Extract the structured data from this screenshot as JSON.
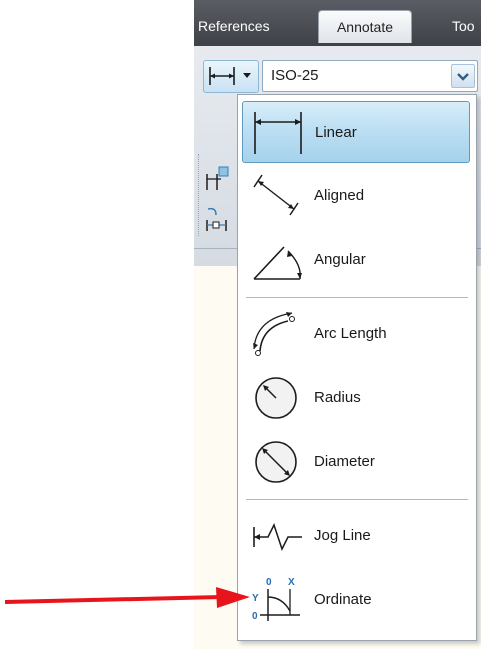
{
  "ribbon": {
    "tabs": [
      {
        "label": "References"
      },
      {
        "label": "Annotate",
        "active": true
      },
      {
        "label": "Too"
      }
    ]
  },
  "dim_style": {
    "value": "ISO-25"
  },
  "dimension_menu": {
    "selected_item": "Linear",
    "items": [
      {
        "label": "Linear",
        "icon": "linear-dimension-icon"
      },
      {
        "label": "Aligned",
        "icon": "aligned-dimension-icon"
      },
      {
        "label": "Angular",
        "icon": "angular-dimension-icon"
      },
      {
        "label": "Arc Length",
        "icon": "arc-length-icon"
      },
      {
        "label": "Radius",
        "icon": "radius-icon"
      },
      {
        "label": "Diameter",
        "icon": "diameter-icon"
      },
      {
        "label": "Jog Line",
        "icon": "jog-line-icon"
      },
      {
        "label": "Ordinate",
        "icon": "ordinate-icon"
      }
    ]
  },
  "colors": {
    "accent": "#bcdff3",
    "ribbon_dark": "#4a4d53",
    "annotation_arrow": "#e8141b"
  }
}
